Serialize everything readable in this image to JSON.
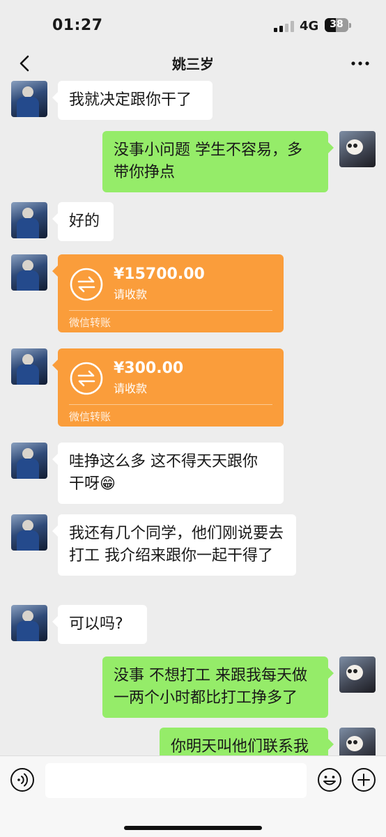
{
  "status_bar": {
    "time": "01:27",
    "network": "4G",
    "battery": "38"
  },
  "header": {
    "title": "姚三岁"
  },
  "messages": [
    {
      "side": "left",
      "text": "我就决定跟你干了"
    },
    {
      "side": "right",
      "text": "没事小问题  学生不容易，多带你挣点"
    },
    {
      "side": "left",
      "text": "好的"
    },
    {
      "side": "left",
      "type": "transfer",
      "amount": "¥15700.00",
      "status": "请收款",
      "footer": "微信转账"
    },
    {
      "side": "left",
      "type": "transfer",
      "amount": "¥300.00",
      "status": "请收款",
      "footer": "微信转账"
    },
    {
      "side": "left",
      "text": "哇挣这么多 这不得天天跟你干呀😁"
    },
    {
      "side": "left",
      "text": "我还有几个同学，他们刚说要去打工 我介绍来跟你一起干得了"
    },
    {
      "side": "left",
      "text": "可以吗?"
    },
    {
      "side": "right",
      "text": "没事 不想打工 来跟我每天做一两个小时都比打工挣多了"
    },
    {
      "side": "right",
      "text": "你明天叫他们联系我"
    }
  ],
  "input_bar": {
    "value": ""
  },
  "colors": {
    "background": "#ededed",
    "bubble_out": "#95ec69",
    "bubble_in": "#ffffff",
    "transfer": "#fa9d3b"
  }
}
